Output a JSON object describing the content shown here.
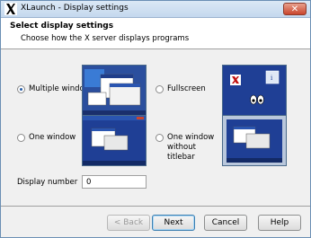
{
  "window": {
    "title": "XLaunch - Display settings",
    "close_glyph": "✕"
  },
  "header": {
    "title": "Select display settings",
    "subtitle": "Choose how the X server displays programs"
  },
  "options": [
    {
      "label": "Multiple windows",
      "selected": true
    },
    {
      "label": "Fullscreen",
      "selected": false
    },
    {
      "label": "One window",
      "selected": false
    },
    {
      "label": "One window without titlebar",
      "selected": false
    }
  ],
  "display_number": {
    "label": "Display number",
    "value": "0"
  },
  "buttons": {
    "back": "< Back",
    "next": "Next",
    "cancel": "Cancel",
    "help": "Help"
  },
  "colors": {
    "desktop_blue": "#1e3f8f",
    "close_red": "#c9452d",
    "accent": "#3c7fb1"
  }
}
